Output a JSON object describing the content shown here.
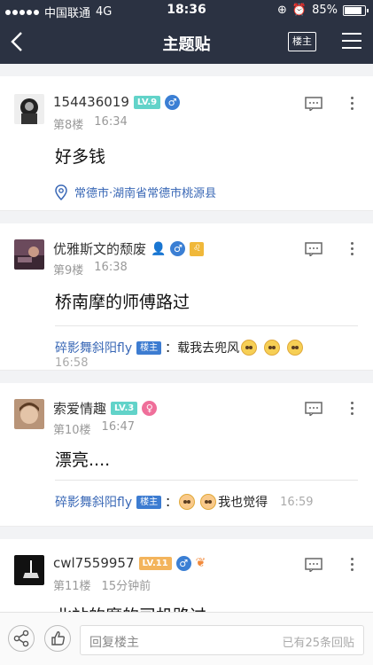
{
  "status_bar": {
    "carrier": "中国联通",
    "network": "4G",
    "time": "18:36",
    "battery": "85%",
    "battery_level": 0.85
  },
  "nav": {
    "back_icon": "back-arrow-icon",
    "title": "主题贴",
    "op_filter_label": "楼主",
    "menu_icon": "hamburger-menu-icon"
  },
  "posts": [
    {
      "username": "154436019",
      "level": "LV.9",
      "gender": "♂",
      "floor": "第8楼",
      "time": "16:34",
      "text": "好多钱",
      "location": "常德市·湖南省常德市桃源县"
    },
    {
      "username": "优雅斯文的颓废",
      "gender": "♂",
      "zodiac": "♌",
      "floor": "第9楼",
      "time": "16:38",
      "text": "桥南摩的师傅路过",
      "reply": {
        "name": "碎影舞斜阳fly",
        "tag": "楼主",
        "text": "：载我去兜风",
        "time": "16:58"
      }
    },
    {
      "username": "索爱情趣",
      "level": "LV.3",
      "gender": "♀",
      "floor": "第10楼",
      "time": "16:47",
      "text": "漂亮....",
      "reply": {
        "name": "碎影舞斜阳fly",
        "tag": "楼主",
        "prefix": "：",
        "text": "我也觉得",
        "time": "16:59"
      }
    },
    {
      "username": "cwl7559957",
      "level": "LV.11",
      "gender": "♂",
      "floor": "第11楼",
      "time": "15分钟前",
      "text": "北站的摩的司机路过"
    }
  ],
  "bottom_bar": {
    "placeholder": "回复楼主",
    "reply_count": "已有25条回贴"
  },
  "colors": {
    "header_bg": "#2b3242",
    "link_blue": "#3a68b6",
    "op_tag": "#3d7cd1"
  }
}
